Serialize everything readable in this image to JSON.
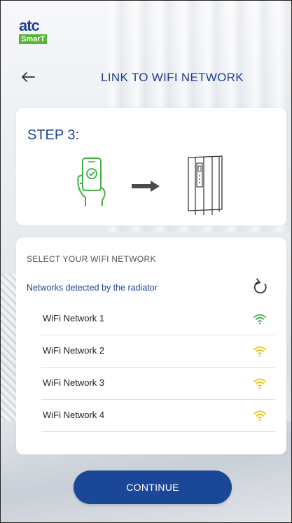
{
  "brand": {
    "name_top": "atc",
    "name_bottom": "SmarT",
    "primary_color": "#1f3f94",
    "accent_color": "#56b531"
  },
  "header": {
    "back_icon": "arrow-left-icon",
    "title": "LINK TO WIFI NETWORK"
  },
  "step": {
    "label": "STEP 3:"
  },
  "wifi_section": {
    "title": "SELECT YOUR WIFI NETWORK",
    "detected_label": "Networks detected by the radiator",
    "refresh_icon": "refresh-icon",
    "networks": [
      {
        "name": "WiFi Network 1",
        "signal_color": "#3cb043",
        "icon": "wifi-icon"
      },
      {
        "name": "WiFi Network 2",
        "signal_color": "#f2c200",
        "icon": "wifi-icon"
      },
      {
        "name": "WiFi Network 3",
        "signal_color": "#f2c200",
        "icon": "wifi-icon"
      },
      {
        "name": "WiFi Network 4",
        "signal_color": "#f2c200",
        "icon": "wifi-icon"
      }
    ]
  },
  "footer": {
    "continue_label": "CONTINUE"
  }
}
